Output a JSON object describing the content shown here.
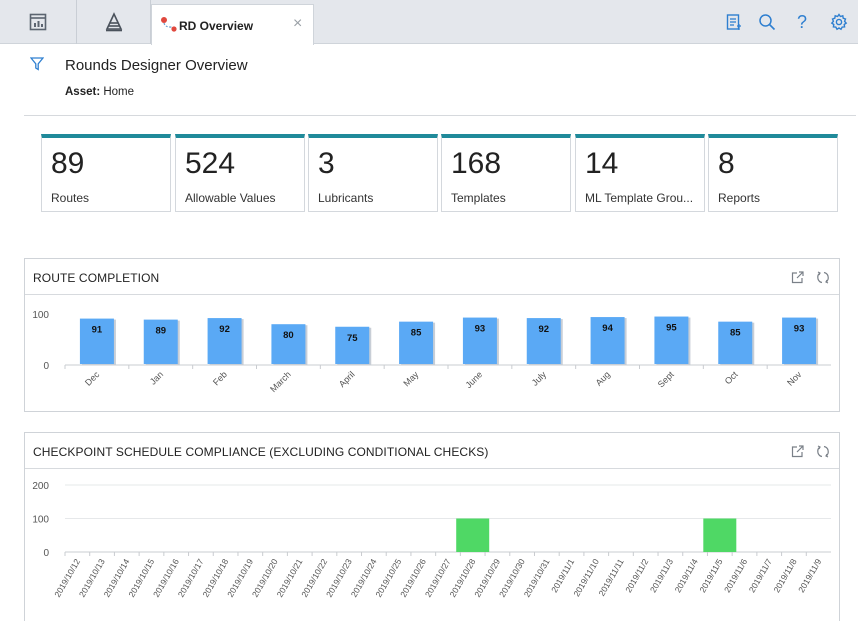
{
  "topbar": {
    "nav_icons": [
      "dashboard-icon",
      "rounds-icon"
    ],
    "tab": {
      "label": "RD Overview",
      "icon": "route-pin-icon",
      "close": "×"
    },
    "right_icons": [
      "report-icon",
      "search-icon",
      "help-icon",
      "settings-icon"
    ],
    "help_glyph": "?"
  },
  "header": {
    "title": "Rounds Designer Overview",
    "asset_label": "Asset:",
    "asset_value": "Home"
  },
  "tiles": [
    {
      "value": "89",
      "label": "Routes"
    },
    {
      "value": "524",
      "label": "Allowable Values"
    },
    {
      "value": "3",
      "label": "Lubricants"
    },
    {
      "value": "168",
      "label": "Templates"
    },
    {
      "value": "14",
      "label": "ML Template Grou..."
    },
    {
      "value": "8",
      "label": "Reports"
    }
  ],
  "colors": {
    "tile_accent": "#1f8a9a",
    "bar_blue": "#5aa9f5",
    "bar_green": "#4fd865"
  },
  "route_completion": {
    "title": "ROUTE COMPLETION",
    "chart_data": {
      "type": "bar",
      "categories": [
        "Dec",
        "Jan",
        "Feb",
        "March",
        "April",
        "May",
        "June",
        "July",
        "Aug",
        "Sept",
        "Oct",
        "Nov"
      ],
      "values": [
        91,
        89,
        92,
        80,
        75,
        85,
        93,
        92,
        94,
        95,
        85,
        93
      ],
      "ylim": [
        0,
        100
      ],
      "yticks": [
        "0",
        "100"
      ],
      "data_labels": true,
      "grid": false
    }
  },
  "checkpoint": {
    "title": "CHECKPOINT SCHEDULE COMPLIANCE (EXCLUDING CONDITIONAL CHECKS)",
    "chart_data": {
      "type": "bar",
      "categories": [
        "2019/10/12",
        "2019/10/13",
        "2019/10/14",
        "2019/10/15",
        "2019/10/16",
        "2019/10/17",
        "2019/10/18",
        "2019/10/19",
        "2019/10/20",
        "2019/10/21",
        "2019/10/22",
        "2019/10/23",
        "2019/10/24",
        "2019/10/25",
        "2019/10/26",
        "2019/10/27",
        "2019/10/28",
        "2019/10/29",
        "2019/10/30",
        "2019/10/31",
        "2019/11/1",
        "2019/11/10",
        "2019/11/11",
        "2019/11/2",
        "2019/11/3",
        "2019/11/4",
        "2019/11/5",
        "2019/11/6",
        "2019/11/7",
        "2019/11/8",
        "2019/11/9"
      ],
      "values": [
        0,
        0,
        0,
        0,
        0,
        0,
        0,
        0,
        0,
        0,
        0,
        0,
        0,
        0,
        0,
        0,
        100,
        0,
        0,
        0,
        0,
        0,
        0,
        0,
        0,
        0,
        100,
        0,
        0,
        0,
        0
      ],
      "ylim": [
        0,
        200
      ],
      "yticks": [
        "0",
        "100",
        "200"
      ],
      "grid": true
    }
  },
  "card_actions": [
    "expand-icon",
    "refresh-icon"
  ]
}
